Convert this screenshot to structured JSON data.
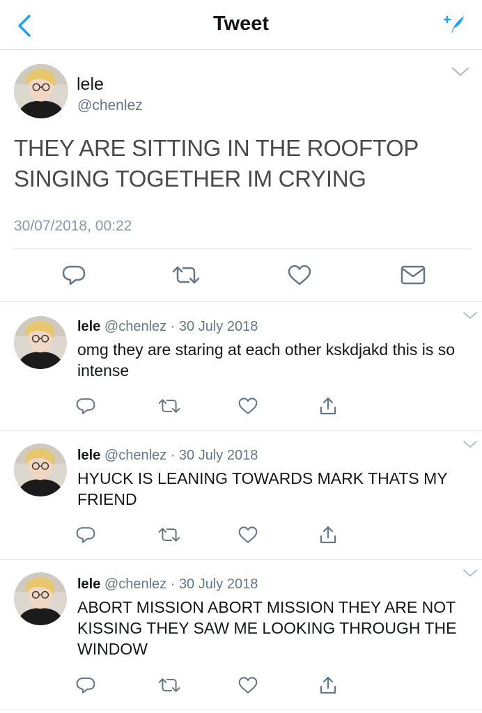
{
  "header": {
    "title": "Tweet",
    "back_icon": "chevron-left-icon",
    "compose_icon": "compose-tweet-icon",
    "accent_color": "#1da1f2"
  },
  "main_tweet": {
    "name": "lele",
    "handle": "@chenlez",
    "text": "THEY ARE SITTING IN THE ROOFTOP SINGING TOGETHER IM CRYING",
    "timestamp": "30/07/2018, 00:22",
    "actions": [
      "reply-icon",
      "retweet-icon",
      "like-icon",
      "direct-message-icon"
    ]
  },
  "replies": [
    {
      "name": "lele",
      "meta": "@chenlez · 30 July 2018",
      "text": "omg they are staring at each other kskdjakd this is so intense"
    },
    {
      "name": "lele",
      "meta": "@chenlez · 30 July 2018",
      "text": "HYUCK IS LEANING TOWARDS MARK THATS MY FRIEND"
    },
    {
      "name": "lele",
      "meta": "@chenlez · 30 July 2018",
      "text": "ABORT MISSION ABORT MISSION THEY ARE NOT KISSING THEY SAW ME LOOKING THROUGH THE WINDOW"
    }
  ]
}
